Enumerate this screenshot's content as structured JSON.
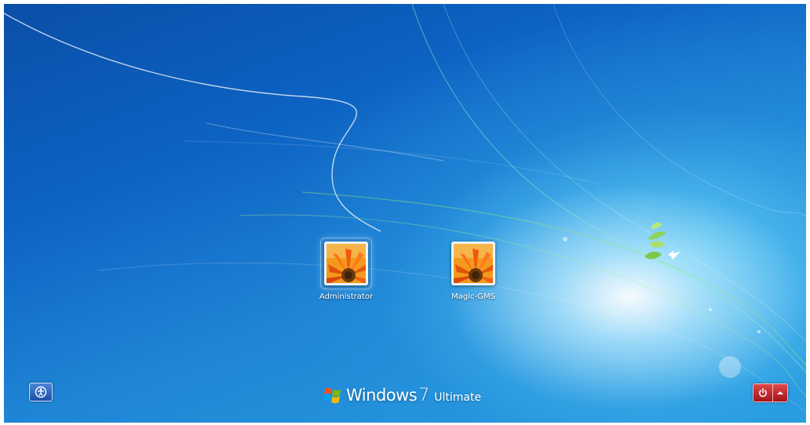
{
  "users": [
    {
      "name": "Administrator",
      "selected": true
    },
    {
      "name": "Magic-GMS",
      "selected": false
    }
  ],
  "branding": {
    "word": "Windows",
    "version": "7",
    "edition": "Ultimate"
  },
  "icons": {
    "ease_of_access": "ease-of-access-icon",
    "power": "power-icon",
    "shutdown_options": "chevron-up-icon",
    "windows_logo": "windows-logo-icon",
    "user_picture": "flower-icon"
  },
  "colors": {
    "desktop_dark": "#0a4fa8",
    "desktop_light": "#2aa0e2",
    "power_red": "#c8262c",
    "ease_blue": "#1c4fa6"
  }
}
